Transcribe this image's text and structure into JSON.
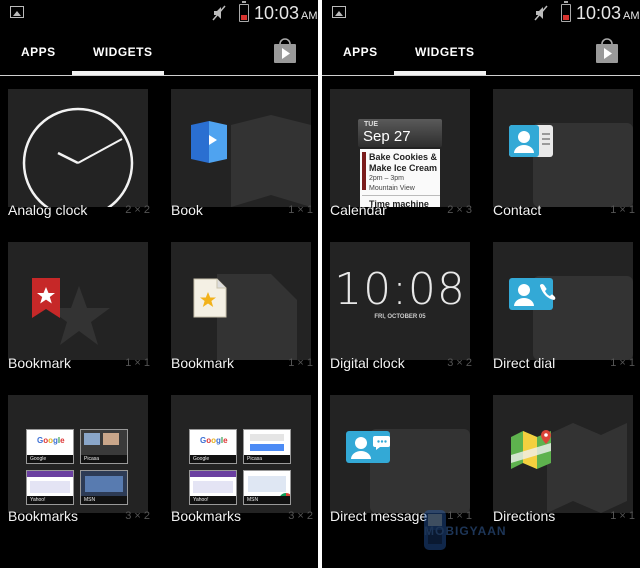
{
  "status_bar": {
    "time": "10:03",
    "ampm": "AM"
  },
  "tabs": {
    "apps": "APPS",
    "widgets": "WIDGETS"
  },
  "left_panel": {
    "widgets": [
      {
        "label": "Analog clock",
        "span": "2 × 2"
      },
      {
        "label": "Book",
        "span": "1 × 1"
      },
      {
        "label": "Bookmark",
        "span": "1 × 1"
      },
      {
        "label": "Bookmark",
        "span": "1 × 1"
      },
      {
        "label": "Bookmarks",
        "span": "3 × 2"
      },
      {
        "label": "Bookmarks",
        "span": "3 × 2"
      }
    ]
  },
  "right_panel": {
    "widgets": [
      {
        "label": "Calendar",
        "span": "2 × 3"
      },
      {
        "label": "Contact",
        "span": "1 × 1"
      },
      {
        "label": "Digital clock",
        "span": "3 × 2"
      },
      {
        "label": "Direct dial",
        "span": "1 × 1"
      },
      {
        "label": "Direct message",
        "span": "1 × 1"
      },
      {
        "label": "Directions",
        "span": "1 × 1"
      }
    ]
  },
  "calendar_preview": {
    "day_of_week": "TUE",
    "date": "Sep 27",
    "event_title": "Bake Cookies & Make Ice Cream",
    "event_time": "2pm – 3pm",
    "event_location": "Mountain View",
    "next_event": "Time machine"
  },
  "digital_clock_preview": {
    "time": "10:08",
    "date": "FRI, OCTOBER 05"
  },
  "bookmark_thumbs_1": [
    "Google",
    "Picasa",
    "Yahoo!",
    "MSN"
  ],
  "bookmark_thumbs_2": [
    "Google",
    "Picasa",
    "Yahoo!",
    "MSN"
  ],
  "watermark": "MOBIGYAAN",
  "colors": {
    "background": "#000000",
    "card": "#232323",
    "indicator": "#f2f2f2",
    "battery_low": "#d8332e"
  }
}
